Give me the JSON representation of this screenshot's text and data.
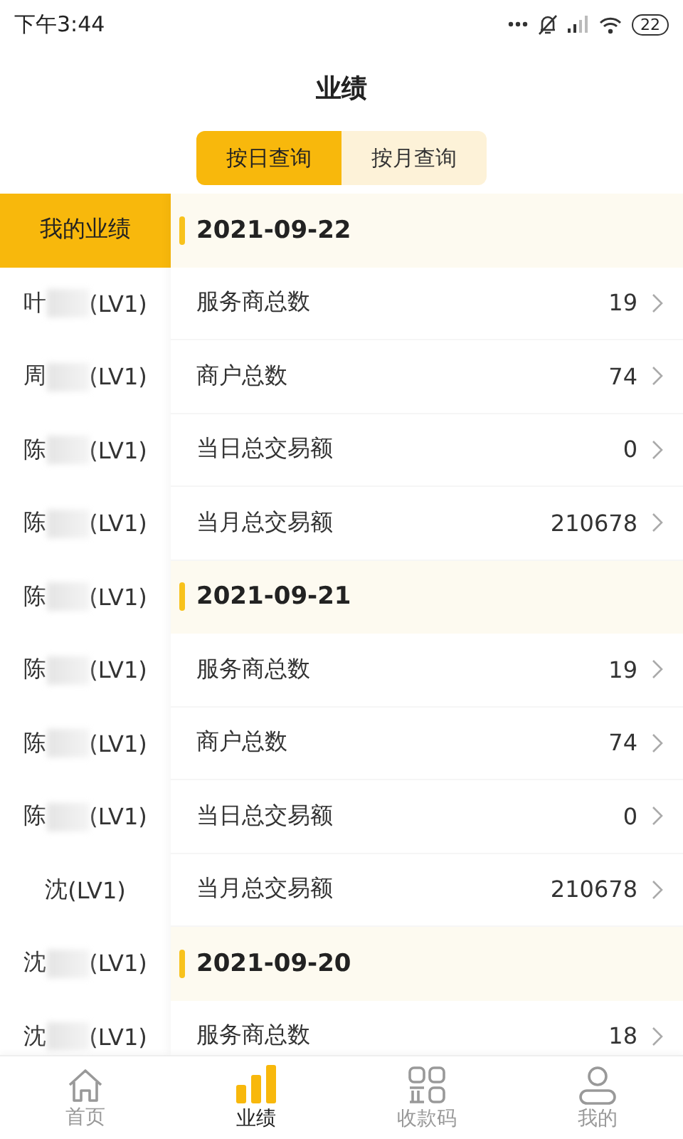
{
  "status_bar": {
    "time": "下午3:44",
    "battery": "22"
  },
  "title": "业绩",
  "tabs": [
    {
      "label": "按日查询",
      "selected": true
    },
    {
      "label": "按月查询",
      "selected": false
    }
  ],
  "sidebar": {
    "items": [
      {
        "name": "我的业绩",
        "selected": true
      },
      {
        "name": "叶",
        "tag": "(LV1)",
        "redacted": true,
        "selected": false
      },
      {
        "name": "周",
        "tag": "(LV1)",
        "redacted": true,
        "selected": false
      },
      {
        "name": "陈",
        "tag": "(LV1)",
        "redacted": true,
        "selected": false
      },
      {
        "name": "陈",
        "tag": "(LV1)",
        "redacted": true,
        "selected": false
      },
      {
        "name": "陈",
        "tag": "(LV1)",
        "redacted": true,
        "selected": false
      },
      {
        "name": "陈",
        "tag": "(LV1)",
        "redacted": true,
        "selected": false
      },
      {
        "name": "陈",
        "tag": "(LV1)",
        "redacted": true,
        "selected": false
      },
      {
        "name": "陈",
        "tag": "(LV1)",
        "redacted": true,
        "selected": false
      },
      {
        "name": "沈",
        "tag": "(LV1)",
        "redacted": false,
        "selected": false
      },
      {
        "name": "沈",
        "tag": "(LV1)",
        "redacted": true,
        "selected": false
      },
      {
        "name": "沈",
        "tag": "(LV1)",
        "redacted": true,
        "selected": false
      }
    ]
  },
  "days": [
    {
      "date": "2021-09-22",
      "rows": [
        {
          "label": "服务商总数",
          "value": "19"
        },
        {
          "label": "商户总数",
          "value": "74"
        },
        {
          "label": "当日总交易额",
          "value": "0"
        },
        {
          "label": "当月总交易额",
          "value": "210678"
        }
      ]
    },
    {
      "date": "2021-09-21",
      "rows": [
        {
          "label": "服务商总数",
          "value": "19"
        },
        {
          "label": "商户总数",
          "value": "74"
        },
        {
          "label": "当日总交易额",
          "value": "0"
        },
        {
          "label": "当月总交易额",
          "value": "210678"
        }
      ]
    },
    {
      "date": "2021-09-20",
      "rows": [
        {
          "label": "服务商总数",
          "value": "18"
        }
      ]
    }
  ],
  "bottom_nav": [
    {
      "label": "首页",
      "selected": false
    },
    {
      "label": "业绩",
      "selected": true
    },
    {
      "label": "收款码",
      "selected": false
    },
    {
      "label": "我的",
      "selected": false
    }
  ]
}
